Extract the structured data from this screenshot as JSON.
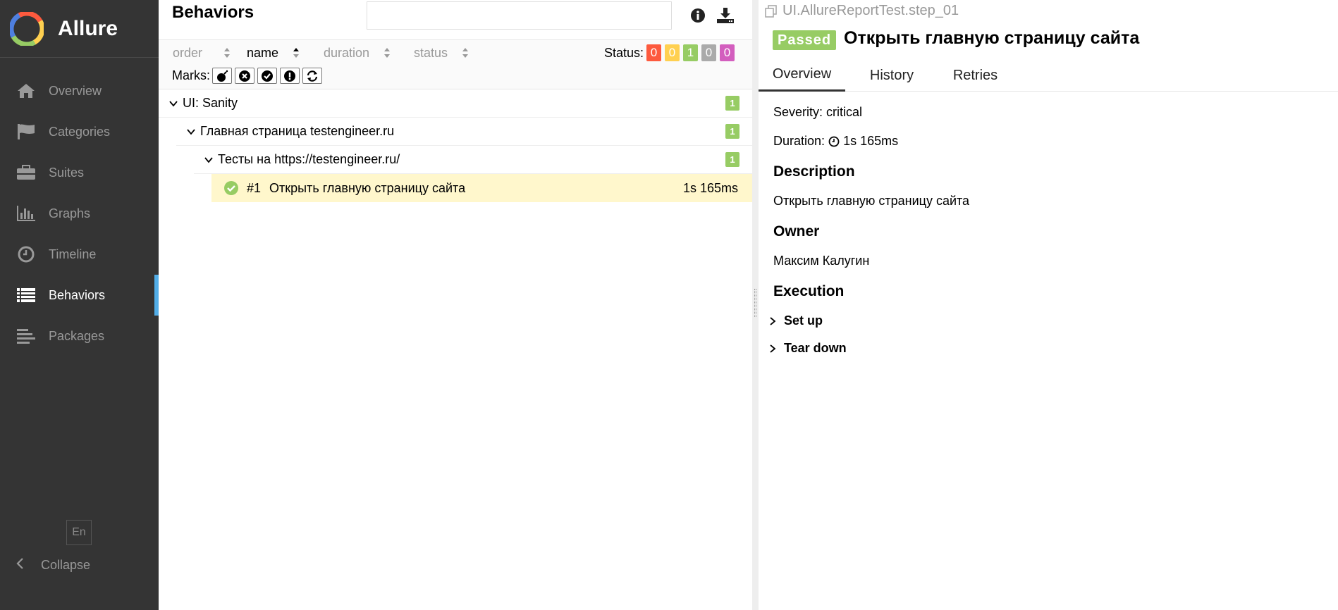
{
  "app": {
    "name": "Allure"
  },
  "sidebar": {
    "items": [
      {
        "label": "Overview",
        "icon": "home-icon"
      },
      {
        "label": "Categories",
        "icon": "flag-icon"
      },
      {
        "label": "Suites",
        "icon": "briefcase-icon"
      },
      {
        "label": "Graphs",
        "icon": "bar-chart-icon"
      },
      {
        "label": "Timeline",
        "icon": "clock-icon"
      },
      {
        "label": "Behaviors",
        "icon": "list-icon",
        "active": true
      },
      {
        "label": "Packages",
        "icon": "align-left-icon"
      }
    ],
    "language": "En",
    "collapse_label": "Collapse"
  },
  "behaviors": {
    "title": "Behaviors",
    "search": {
      "value": "",
      "placeholder": ""
    },
    "sort": {
      "order_label": "order",
      "name_label": "name",
      "duration_label": "duration",
      "status_label": "status",
      "active": "name"
    },
    "status_filter": {
      "label": "Status:",
      "counts": [
        {
          "value": "0",
          "color": "#fd5a3e"
        },
        {
          "value": "0",
          "color": "#ffd050"
        },
        {
          "value": "1",
          "color": "#97cc64"
        },
        {
          "value": "0",
          "color": "#aaaaaa"
        },
        {
          "value": "0",
          "color": "#d35ebe"
        }
      ]
    },
    "marks": {
      "label": "Marks:",
      "items": [
        "flaky-bomb-icon",
        "new-failed-icon",
        "new-passed-icon",
        "new-broken-icon",
        "retries-icon"
      ]
    },
    "tree": {
      "epic": {
        "name": "UI: Sanity",
        "count": "1"
      },
      "feature": {
        "name": "Главная страница testengineer.ru",
        "count": "1"
      },
      "story": {
        "name": "Тесты на https://testengineer.ru/",
        "count": "1"
      },
      "test": {
        "number": "#1",
        "name": "Открыть главную страницу сайта",
        "duration": "1s 165ms"
      }
    }
  },
  "testcase": {
    "full_name": "UI.AllureReportTest.step_01",
    "status": "Passed",
    "title": "Открыть главную страницу сайта",
    "tabs": [
      "Overview",
      "History",
      "Retries"
    ],
    "severity_label": "Severity:",
    "severity": "critical",
    "duration_label": "Duration:",
    "duration": "1s 165ms",
    "description_heading": "Description",
    "description": "Открыть главную страницу сайта",
    "owner_heading": "Owner",
    "owner": "Максим Калугин",
    "execution_heading": "Execution",
    "setup_label": "Set up",
    "teardown_label": "Tear down"
  },
  "colors": {
    "sidebar_bg": "#343434",
    "active_accent": "#52aee8",
    "passed": "#97cc64",
    "highlight_row": "#fff7cc"
  }
}
